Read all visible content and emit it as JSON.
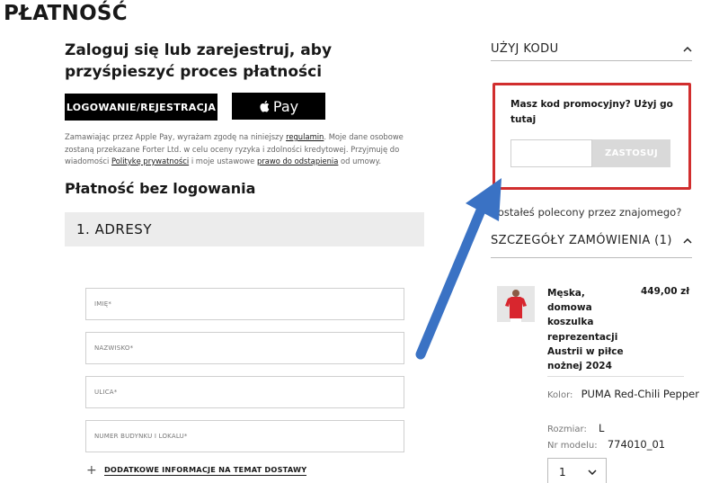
{
  "page": {
    "title": "PŁATNOŚĆ"
  },
  "login": {
    "prompt": "Zaloguj się lub zarejestruj, aby przyśpieszyć proces płatności",
    "login_button": "LOGOWANIE/REJESTRACJA",
    "apple_pay_label": "Pay"
  },
  "legal": {
    "part1": "Zamawiając przez Apple Pay, wyrażam zgodę na niniejszy ",
    "link_terms": "regulamin",
    "part2": ". Moje dane osobowe zostaną przekazane Forter Ltd. w celu oceny ryzyka i zdolności kredytowej. Przyjmuję do wiadomości ",
    "link_privacy": "Politykę prywatności",
    "part3": " i moje ustawowe ",
    "link_withdrawal": "prawo do odstąpienia",
    "part4": " od umowy."
  },
  "guest": {
    "heading": "Płatność bez logowania"
  },
  "addresses": {
    "section_title": "1. ADRESY",
    "fields": {
      "first_name": "IMIĘ*",
      "last_name": "NAZWISKO*",
      "street": "ULICA*",
      "building": "NUMER BUDYNKU I LOKALU*"
    },
    "extra_info": "DODATKOWE INFORMACJE NA TEMAT DOSTAWY"
  },
  "promo": {
    "header": "UŻYJ KODU",
    "question": "Masz kod promocyjny? Użyj go tutaj",
    "input_value": "",
    "apply_button": "ZASTOSUJ",
    "referral": "Zostałeś polecony przez znajomego?"
  },
  "order": {
    "header": "SZCZEGÓŁY ZAMÓWIENIA (1)",
    "item": {
      "name": "Męska, domowa koszulka reprezentacji Austrii w piłce nożnej 2024",
      "price": "449,00 zł",
      "color_label": "Kolor:",
      "color_value": "PUMA Red-Chili Pepper",
      "size_label": "Rozmiar:",
      "size_value": "L",
      "model_label": "Nr modelu:",
      "model_value": "774010_01",
      "quantity": "1"
    }
  },
  "colors": {
    "highlight": "#d12e2e",
    "arrow": "#3a72c4",
    "button_dark": "#000000",
    "button_disabled": "#d9d9d9"
  },
  "icons": [
    "apple-icon",
    "chevron-up-icon",
    "chevron-down-icon",
    "plus-icon",
    "arrow-annotation"
  ]
}
